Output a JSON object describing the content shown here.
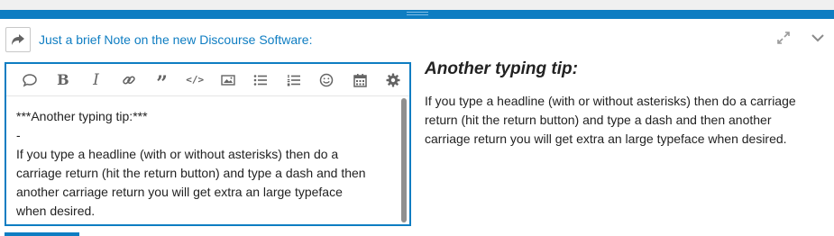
{
  "composer": {
    "reply_title": "Just a brief Note on the new Discourse Software:",
    "icons": {
      "reply": "reply-arrow-icon",
      "expand": "expand-diagonal-icon",
      "collapse": "chevron-down-icon"
    }
  },
  "toolbar": {
    "buttons": [
      {
        "name": "quote-bubble-icon"
      },
      {
        "name": "bold-icon",
        "glyph": "B"
      },
      {
        "name": "italic-icon",
        "glyph": "I"
      },
      {
        "name": "link-icon"
      },
      {
        "name": "blockquote-icon",
        "glyph": "”"
      },
      {
        "name": "code-icon",
        "glyph": "</>"
      },
      {
        "name": "image-icon"
      },
      {
        "name": "bulleted-list-icon"
      },
      {
        "name": "numbered-list-icon"
      },
      {
        "name": "emoji-icon"
      },
      {
        "name": "calendar-icon"
      },
      {
        "name": "gear-icon"
      }
    ]
  },
  "editor": {
    "lines": [
      "***Another typing tip:***",
      "-",
      "If you type a headline (with or without asterisks) then do a",
      "carriage return (hit the return button) and type a dash and then",
      "another carriage return you will get extra an large typeface",
      "when desired."
    ]
  },
  "preview": {
    "heading": "Another typing tip:",
    "lines": [
      "If you type a headline (with or without asterisks) then do a carriage",
      "return (hit the return button) and type a dash and then another",
      "carriage return you will get extra an large typeface when desired."
    ]
  },
  "colors": {
    "accent": "#0e7dc2",
    "text": "#222222",
    "icon": "#646464"
  }
}
